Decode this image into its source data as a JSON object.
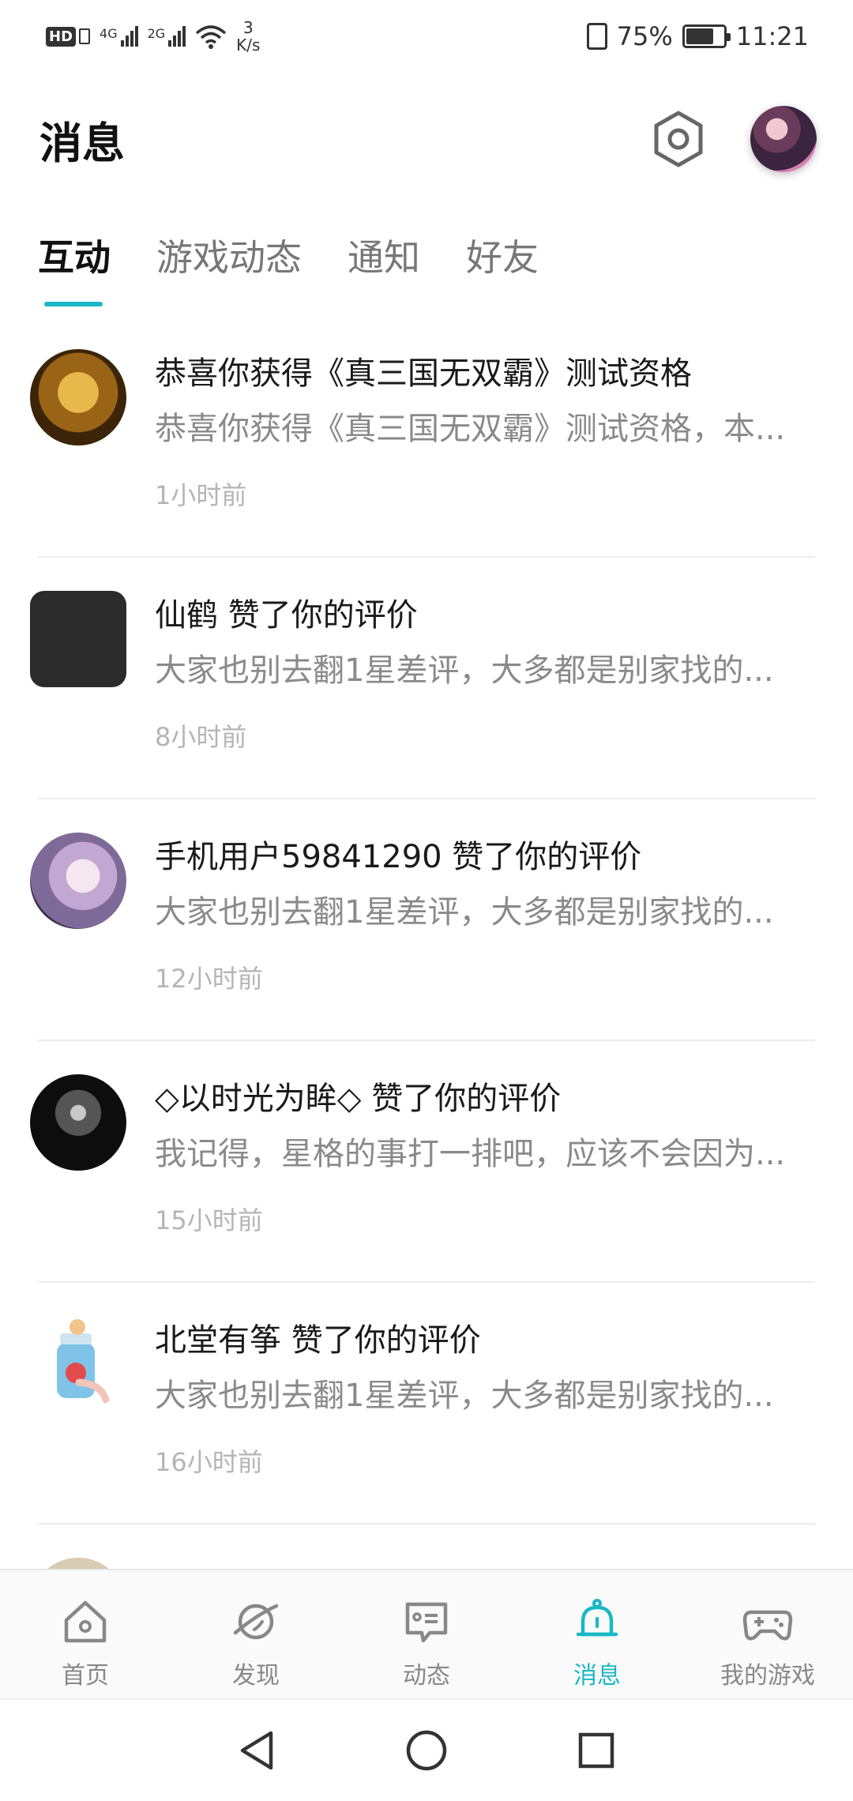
{
  "status_bar": {
    "hd": "HD",
    "net1": "4G",
    "net2": "2G",
    "speed_value": "3",
    "speed_unit": "K/s",
    "battery_percent": "75%",
    "battery_level": 0.75,
    "time": "11:21"
  },
  "header": {
    "title": "消息"
  },
  "tabs": [
    {
      "label": "互动",
      "active": true
    },
    {
      "label": "游戏动态",
      "active": false
    },
    {
      "label": "通知",
      "active": false
    },
    {
      "label": "好友",
      "active": false
    }
  ],
  "messages": [
    {
      "title": "恭喜你获得《真三国无双霸》测试资格",
      "preview": "恭喜你获得《真三国无双霸》测试资格，本...",
      "time": "1小时前"
    },
    {
      "title": "仙鹤 赞了你的评价",
      "preview": "大家也别去翻1星差评，大多都是别家找的...",
      "time": "8小时前"
    },
    {
      "title": "手机用户59841290 赞了你的评价",
      "preview": "大家也别去翻1星差评，大多都是别家找的...",
      "time": "12小时前"
    },
    {
      "title": "◇以时光为眸◇ 赞了你的评价",
      "preview": "我记得，星格的事打一排吧，应该不会因为...",
      "time": "15小时前"
    },
    {
      "title": "北堂有筝 赞了你的评价",
      "preview": "大家也别去翻1星差评，大多都是别家找的...",
      "time": "16小时前"
    }
  ],
  "bottom_nav": [
    {
      "label": "首页",
      "icon": "home-icon",
      "active": false
    },
    {
      "label": "发现",
      "icon": "planet-icon",
      "active": false
    },
    {
      "label": "动态",
      "icon": "chat-icon",
      "active": false
    },
    {
      "label": "消息",
      "icon": "bell-icon",
      "active": true
    },
    {
      "label": "我的游戏",
      "icon": "gamepad-icon",
      "active": false
    }
  ],
  "colors": {
    "accent": "#19b8c4",
    "text_primary": "#1a1a1a",
    "text_secondary": "#8a8a8a",
    "text_muted": "#b5b5b5"
  }
}
